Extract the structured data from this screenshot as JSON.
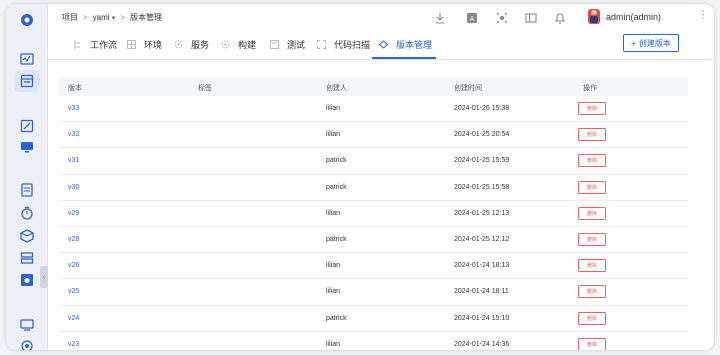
{
  "breadcrumb": {
    "project": "项目",
    "sep1": ">",
    "project_name": "yami",
    "caret": "▾",
    "sep2": ">",
    "page": "版本管理"
  },
  "user": {
    "name": "admin(admin)"
  },
  "tabs": [
    {
      "label": "工作流",
      "icon": "workflow-icon"
    },
    {
      "label": "环境",
      "icon": "grid-icon"
    },
    {
      "label": "服务",
      "icon": "gear-icon"
    },
    {
      "label": "构建",
      "icon": "gear-icon"
    },
    {
      "label": "测试",
      "icon": "test-icon"
    },
    {
      "label": "代码扫描",
      "icon": "scan-icon"
    },
    {
      "label": "版本管理",
      "icon": "version-icon"
    }
  ],
  "create_button": {
    "plus": "+",
    "label": "创建版本"
  },
  "table": {
    "headers": [
      "版本",
      "标签",
      "创建人",
      "创建时间",
      "操作"
    ],
    "rows": [
      {
        "version": "v33",
        "tag": "",
        "creator": "lilian",
        "time": "2024-01-26 15:38",
        "action": "删除"
      },
      {
        "version": "v32",
        "tag": "",
        "creator": "lilian",
        "time": "2024-01-25 20:54",
        "action": "删除"
      },
      {
        "version": "v31",
        "tag": "",
        "creator": "patrick",
        "time": "2024-01-25 15:59",
        "action": "删除"
      },
      {
        "version": "v30",
        "tag": "",
        "creator": "patrick",
        "time": "2024-01-25 15:58",
        "action": "删除"
      },
      {
        "version": "v29",
        "tag": "",
        "creator": "lilian",
        "time": "2024-01-25 12:13",
        "action": "删除"
      },
      {
        "version": "v28",
        "tag": "",
        "creator": "patrick",
        "time": "2024-01-25 12:12",
        "action": "删除"
      },
      {
        "version": "v26",
        "tag": "",
        "creator": "lilian",
        "time": "2024-01-24 18:13",
        "action": "删除"
      },
      {
        "version": "v25",
        "tag": "",
        "creator": "lilian",
        "time": "2024-01-24 18:11",
        "action": "删除"
      },
      {
        "version": "v24",
        "tag": "",
        "creator": "patrick",
        "time": "2024-01-24 15:10",
        "action": "删除"
      },
      {
        "version": "v23",
        "tag": "",
        "creator": "lilian",
        "time": "2024-01-24 14:36",
        "action": "删除"
      }
    ]
  },
  "colors": {
    "accent": "#2e62d9",
    "danger": "#e06666",
    "sidebar_bg": "#eef0f7"
  }
}
